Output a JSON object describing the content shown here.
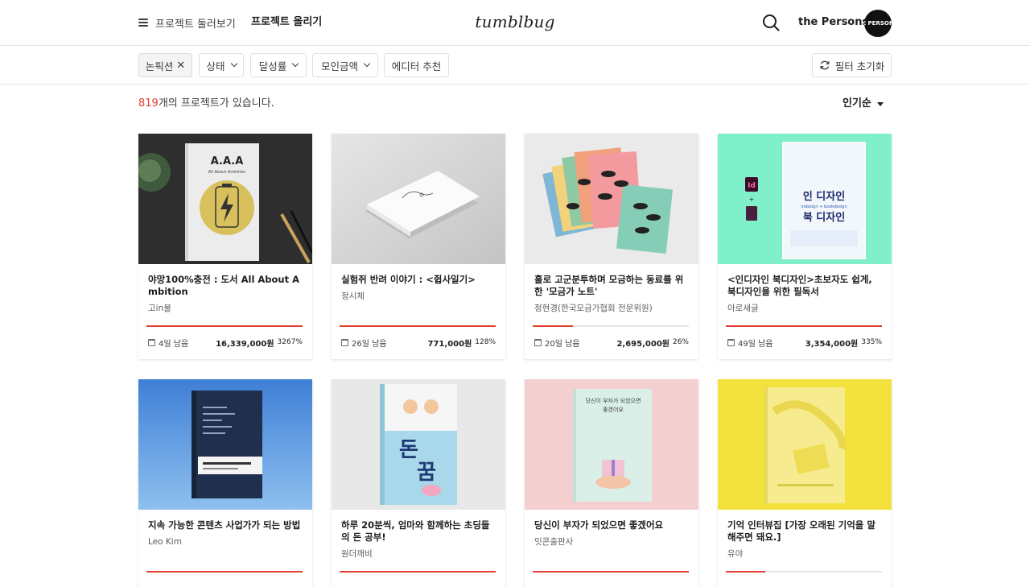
{
  "header": {
    "browse_label": "프로젝트 둘러보기",
    "create_label": "프로젝트 올리기",
    "logo": "tumblbug",
    "user_name": "the Persons",
    "avatar_text": "E PERSON"
  },
  "filters": {
    "chips": [
      "논픽션",
      "상태",
      "달성률",
      "모인금액",
      "에디터 추천"
    ],
    "reset_label": "필터 초기화"
  },
  "results": {
    "count": "819",
    "suffix": "개의 프로젝트가 있습니다.",
    "sort_label": "인기순"
  },
  "thumb_text": {
    "c0_title": "A.A.A",
    "c0_sub": "All About Ambition",
    "c3_top": "인 디자인",
    "c3_bottom": "북 디자인",
    "c3_mid": "indesign + bookdesign",
    "c3_id": "Id",
    "c5_big1": "돈",
    "c5_big2": "꿈",
    "c6_text": "당신이 부자가 되었으면 좋겠어요"
  },
  "colors": {
    "accent": "#e23d2e"
  },
  "projects": [
    {
      "title": "야망100%충전 : 도서 All About Ambition",
      "creator": "고in물",
      "days": "4일 남음",
      "amount": "16,339,000원",
      "percent": "3267%",
      "progress": 1.0
    },
    {
      "title": "실험쥐 반려 이야기 : <쥡사일기>",
      "creator": "정시체",
      "days": "26일 남음",
      "amount": "771,000원",
      "percent": "128%",
      "progress": 1.0
    },
    {
      "title": "홀로 고군분투하며 모금하는 동료를 위한 '모금가 노트'",
      "creator": "정현경(한국모금가협회 전문위원)",
      "days": "20일 남음",
      "amount": "2,695,000원",
      "percent": "26%",
      "progress": 0.26
    },
    {
      "title": "<인디자인 북디자인>초보자도 쉽게, 북디자인을 위한 필독서",
      "creator": "아로새글",
      "days": "49일 남음",
      "amount": "3,354,000원",
      "percent": "335%",
      "progress": 1.0
    },
    {
      "title": "지속 가능한 콘텐츠 사업가가 되는 방법",
      "creator": "Leo Kim",
      "days": "",
      "amount": "",
      "percent": "",
      "progress": 1.0
    },
    {
      "title": "하루 20분씩, 엄마와 함께하는 초딩들의 돈 공부!",
      "creator": "원더깨비",
      "days": "",
      "amount": "",
      "percent": "",
      "progress": 1.0
    },
    {
      "title": "당신이 부자가 되었으면 좋겠어요",
      "creator": "잇콘출판사",
      "days": "",
      "amount": "",
      "percent": "",
      "progress": 1.0
    },
    {
      "title": "기억 인터뷰집 [가장 오래된 기억을 말해주면 돼요.]",
      "creator": "유야",
      "days": "",
      "amount": "",
      "percent": "",
      "progress": 0.25
    }
  ]
}
